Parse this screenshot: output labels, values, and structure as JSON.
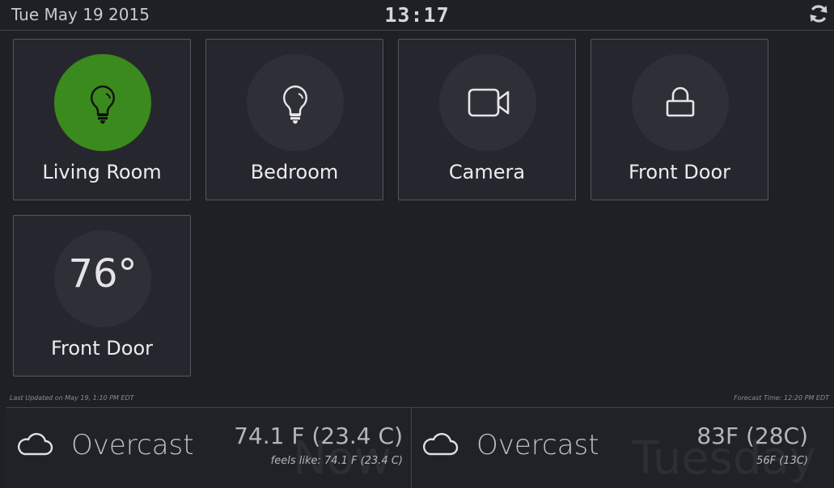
{
  "header": {
    "date": "Tue May 19 2015",
    "time": "13:17",
    "refresh_icon": "refresh-icon"
  },
  "tiles": [
    {
      "label": "Living Room",
      "icon": "lightbulb-icon",
      "state": "on",
      "accent": "#3a8a1d"
    },
    {
      "label": "Bedroom",
      "icon": "lightbulb-icon",
      "state": "off"
    },
    {
      "label": "Camera",
      "icon": "video-camera-icon"
    },
    {
      "label": "Front Door",
      "icon": "lock-icon"
    },
    {
      "label": "Front Door",
      "value": "76°",
      "icon": "thermostat"
    }
  ],
  "footer": {
    "last_updated": "Last Updated on May 19, 1:10 PM EDT",
    "forecast_time": "Forecast Time: 12:20 PM EDT"
  },
  "weather": {
    "now": {
      "ghost": "Now",
      "icon": "cloud-icon",
      "condition": "Overcast",
      "temperature": "74.1 F (23.4 C)",
      "feels_like": "feels like: 74.1 F (23.4 C)"
    },
    "forecast": {
      "ghost": "Tuesday",
      "icon": "cloud-icon",
      "condition": "Overcast",
      "high": "83F (28C)",
      "low": "56F (13C)"
    }
  }
}
